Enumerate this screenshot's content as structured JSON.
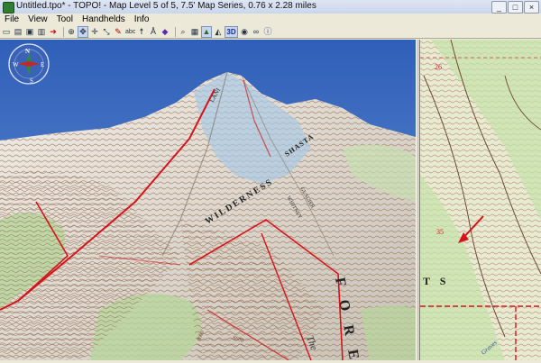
{
  "window": {
    "title": "Untitled.tpo* - TOPO! - Map Level 5 of 5, 7.5' Map Series, 0.76 x 2.28 miles",
    "buttons": [
      "_",
      "□",
      "×"
    ]
  },
  "menu": {
    "items": [
      "File",
      "View",
      "Tool",
      "Handhelds",
      "Info"
    ]
  },
  "toolbar": {
    "icons": [
      "new-icon",
      "open-icon",
      "save-icon",
      "print-icon",
      "export-icon",
      "zoom-in-icon",
      "pan-icon",
      "move-icon",
      "route-icon",
      "pen-icon",
      "text-icon",
      "figure-icon",
      "compass-tool-icon",
      "diamond-icon",
      "search-icon",
      "grid-icon",
      "terrain-icon",
      "profile-icon",
      "3d-icon",
      "photo-icon",
      "binoculars-icon",
      "info-icon"
    ],
    "3d_label": "3D"
  },
  "map3d": {
    "compass": {
      "n": "N",
      "s": "S",
      "e": "E",
      "w": "W"
    },
    "labels": {
      "peak": "LANI",
      "shasta": "SHASTA",
      "wilderness": "WILDERNESS",
      "whitney": "WHITNEY",
      "glacier": "GLACIER",
      "forest": "F O R E",
      "the": "The",
      "elev1": "8000",
      "elev2": "6600"
    }
  },
  "map2d": {
    "labels": {
      "n26": "26",
      "n35": "35",
      "ts": "T S",
      "name": "Graves"
    }
  },
  "colors": {
    "sky": "#3f6cc0",
    "terrain_light": "#eae7df",
    "contour": "#9c6b4f",
    "boundary_red": "#d4141a",
    "forest_green": "#b6d59a",
    "glacier_blue": "#a9c9e4"
  }
}
